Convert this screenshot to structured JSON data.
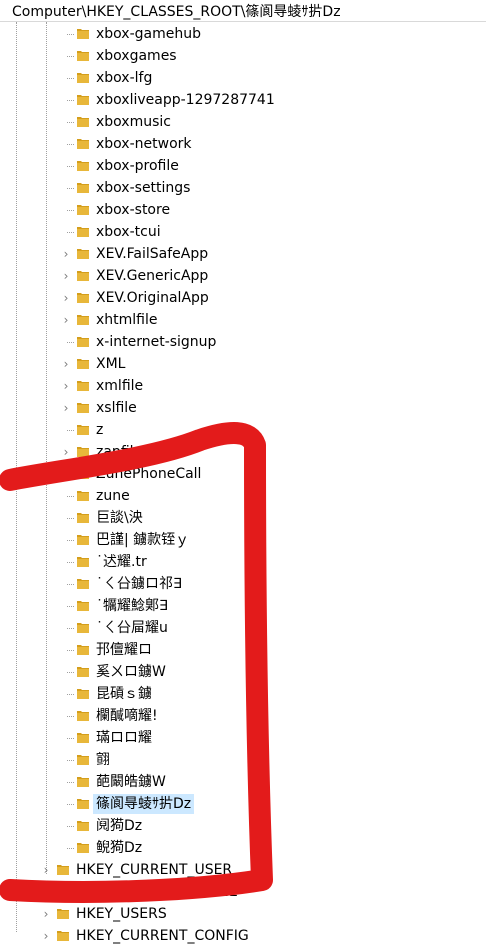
{
  "address_bar": {
    "path": "Computer\\HKEY_CLASSES_ROOT\\篠阆㝵䗀ｻ扸Dz"
  },
  "tree": {
    "items": [
      {
        "label": "xbox-gamehub",
        "expandable": false
      },
      {
        "label": "xboxgames",
        "expandable": false
      },
      {
        "label": "xbox-lfg",
        "expandable": false
      },
      {
        "label": "xboxliveapp-1297287741",
        "expandable": false
      },
      {
        "label": "xboxmusic",
        "expandable": false
      },
      {
        "label": "xbox-network",
        "expandable": false
      },
      {
        "label": "xbox-profile",
        "expandable": false
      },
      {
        "label": "xbox-settings",
        "expandable": false
      },
      {
        "label": "xbox-store",
        "expandable": false
      },
      {
        "label": "xbox-tcui",
        "expandable": false
      },
      {
        "label": "XEV.FailSafeApp",
        "expandable": true
      },
      {
        "label": "XEV.GenericApp",
        "expandable": true
      },
      {
        "label": "XEV.OriginalApp",
        "expandable": true
      },
      {
        "label": "xhtmlfile",
        "expandable": true
      },
      {
        "label": "x-internet-signup",
        "expandable": false
      },
      {
        "label": "XML",
        "expandable": true
      },
      {
        "label": "xmlfile",
        "expandable": true
      },
      {
        "label": "xslfile",
        "expandable": true
      },
      {
        "label": "z",
        "expandable": false
      },
      {
        "label": "zapfil",
        "expandable": true
      },
      {
        "label": "ZunePhoneCall",
        "expandable": true
      },
      {
        "label": "zune",
        "expandable": false
      },
      {
        "label": "巨談\\泱",
        "expandable": false
      },
      {
        "label": "巴謹| 鐪款铚ｙ",
        "expandable": false
      },
      {
        "label": "˙迖耀.tr",
        "expandable": false
      },
      {
        "label": "˙ㄑ㕣鐪ロ祁∃",
        "expandable": false
      },
      {
        "label": "˙犡耀鯰鄓∃",
        "expandable": false
      },
      {
        "label": "˙ㄑ㕣屇耀u",
        "expandable": false
      },
      {
        "label": "邘儃耀ロ",
        "expandable": false
      },
      {
        "label": "奚ㄨロ鐪W",
        "expandable": false
      },
      {
        "label": "昆碽ｓ鐪",
        "expandable": false
      },
      {
        "label": "欄醎嘀耀!",
        "expandable": false
      },
      {
        "label": "璊ロロ耀",
        "expandable": false
      },
      {
        "label": "翧",
        "expandable": false
      },
      {
        "label": "葩闞皓鐪W",
        "expandable": false
      },
      {
        "label": "篠阆㝵䗀ｻ扸Dz",
        "expandable": false,
        "selected": true
      },
      {
        "label": "阋㺃Dz",
        "expandable": false
      },
      {
        "label": "鲵㺃Dz",
        "expandable": false
      },
      {
        "label": "HKEY_CURRENT_USER",
        "expandable": true,
        "level": 0
      },
      {
        "label": "HKEY_LOCAL_MACHINE",
        "expandable": true,
        "level": 0
      },
      {
        "label": "HKEY_USERS",
        "expandable": true,
        "level": 0
      },
      {
        "label": "HKEY_CURRENT_CONFIG",
        "expandable": true,
        "level": 0
      }
    ]
  },
  "colors": {
    "folder": "#e8b73a",
    "folder_dark": "#d49e1c",
    "selected": "#cce8ff",
    "scribble": "#e31b1b"
  },
  "icons": {
    "folder": "folder-icon",
    "chevron": "chevron-right-icon"
  }
}
